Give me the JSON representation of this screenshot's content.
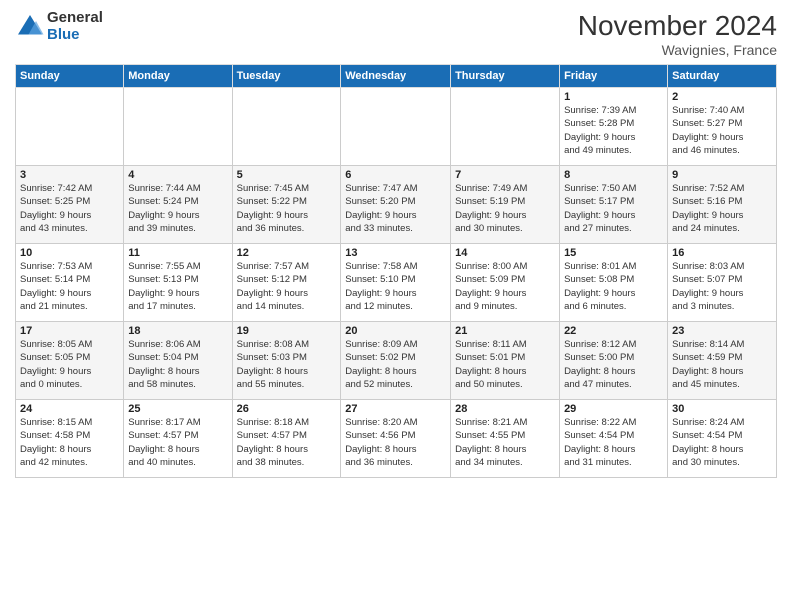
{
  "logo": {
    "general": "General",
    "blue": "Blue"
  },
  "title": "November 2024",
  "subtitle": "Wavignies, France",
  "days_header": [
    "Sunday",
    "Monday",
    "Tuesday",
    "Wednesday",
    "Thursday",
    "Friday",
    "Saturday"
  ],
  "weeks": [
    [
      {
        "day": "",
        "info": ""
      },
      {
        "day": "",
        "info": ""
      },
      {
        "day": "",
        "info": ""
      },
      {
        "day": "",
        "info": ""
      },
      {
        "day": "",
        "info": ""
      },
      {
        "day": "1",
        "info": "Sunrise: 7:39 AM\nSunset: 5:28 PM\nDaylight: 9 hours\nand 49 minutes."
      },
      {
        "day": "2",
        "info": "Sunrise: 7:40 AM\nSunset: 5:27 PM\nDaylight: 9 hours\nand 46 minutes."
      }
    ],
    [
      {
        "day": "3",
        "info": "Sunrise: 7:42 AM\nSunset: 5:25 PM\nDaylight: 9 hours\nand 43 minutes."
      },
      {
        "day": "4",
        "info": "Sunrise: 7:44 AM\nSunset: 5:24 PM\nDaylight: 9 hours\nand 39 minutes."
      },
      {
        "day": "5",
        "info": "Sunrise: 7:45 AM\nSunset: 5:22 PM\nDaylight: 9 hours\nand 36 minutes."
      },
      {
        "day": "6",
        "info": "Sunrise: 7:47 AM\nSunset: 5:20 PM\nDaylight: 9 hours\nand 33 minutes."
      },
      {
        "day": "7",
        "info": "Sunrise: 7:49 AM\nSunset: 5:19 PM\nDaylight: 9 hours\nand 30 minutes."
      },
      {
        "day": "8",
        "info": "Sunrise: 7:50 AM\nSunset: 5:17 PM\nDaylight: 9 hours\nand 27 minutes."
      },
      {
        "day": "9",
        "info": "Sunrise: 7:52 AM\nSunset: 5:16 PM\nDaylight: 9 hours\nand 24 minutes."
      }
    ],
    [
      {
        "day": "10",
        "info": "Sunrise: 7:53 AM\nSunset: 5:14 PM\nDaylight: 9 hours\nand 21 minutes."
      },
      {
        "day": "11",
        "info": "Sunrise: 7:55 AM\nSunset: 5:13 PM\nDaylight: 9 hours\nand 17 minutes."
      },
      {
        "day": "12",
        "info": "Sunrise: 7:57 AM\nSunset: 5:12 PM\nDaylight: 9 hours\nand 14 minutes."
      },
      {
        "day": "13",
        "info": "Sunrise: 7:58 AM\nSunset: 5:10 PM\nDaylight: 9 hours\nand 12 minutes."
      },
      {
        "day": "14",
        "info": "Sunrise: 8:00 AM\nSunset: 5:09 PM\nDaylight: 9 hours\nand 9 minutes."
      },
      {
        "day": "15",
        "info": "Sunrise: 8:01 AM\nSunset: 5:08 PM\nDaylight: 9 hours\nand 6 minutes."
      },
      {
        "day": "16",
        "info": "Sunrise: 8:03 AM\nSunset: 5:07 PM\nDaylight: 9 hours\nand 3 minutes."
      }
    ],
    [
      {
        "day": "17",
        "info": "Sunrise: 8:05 AM\nSunset: 5:05 PM\nDaylight: 9 hours\nand 0 minutes."
      },
      {
        "day": "18",
        "info": "Sunrise: 8:06 AM\nSunset: 5:04 PM\nDaylight: 8 hours\nand 58 minutes."
      },
      {
        "day": "19",
        "info": "Sunrise: 8:08 AM\nSunset: 5:03 PM\nDaylight: 8 hours\nand 55 minutes."
      },
      {
        "day": "20",
        "info": "Sunrise: 8:09 AM\nSunset: 5:02 PM\nDaylight: 8 hours\nand 52 minutes."
      },
      {
        "day": "21",
        "info": "Sunrise: 8:11 AM\nSunset: 5:01 PM\nDaylight: 8 hours\nand 50 minutes."
      },
      {
        "day": "22",
        "info": "Sunrise: 8:12 AM\nSunset: 5:00 PM\nDaylight: 8 hours\nand 47 minutes."
      },
      {
        "day": "23",
        "info": "Sunrise: 8:14 AM\nSunset: 4:59 PM\nDaylight: 8 hours\nand 45 minutes."
      }
    ],
    [
      {
        "day": "24",
        "info": "Sunrise: 8:15 AM\nSunset: 4:58 PM\nDaylight: 8 hours\nand 42 minutes."
      },
      {
        "day": "25",
        "info": "Sunrise: 8:17 AM\nSunset: 4:57 PM\nDaylight: 8 hours\nand 40 minutes."
      },
      {
        "day": "26",
        "info": "Sunrise: 8:18 AM\nSunset: 4:57 PM\nDaylight: 8 hours\nand 38 minutes."
      },
      {
        "day": "27",
        "info": "Sunrise: 8:20 AM\nSunset: 4:56 PM\nDaylight: 8 hours\nand 36 minutes."
      },
      {
        "day": "28",
        "info": "Sunrise: 8:21 AM\nSunset: 4:55 PM\nDaylight: 8 hours\nand 34 minutes."
      },
      {
        "day": "29",
        "info": "Sunrise: 8:22 AM\nSunset: 4:54 PM\nDaylight: 8 hours\nand 31 minutes."
      },
      {
        "day": "30",
        "info": "Sunrise: 8:24 AM\nSunset: 4:54 PM\nDaylight: 8 hours\nand 30 minutes."
      }
    ]
  ]
}
